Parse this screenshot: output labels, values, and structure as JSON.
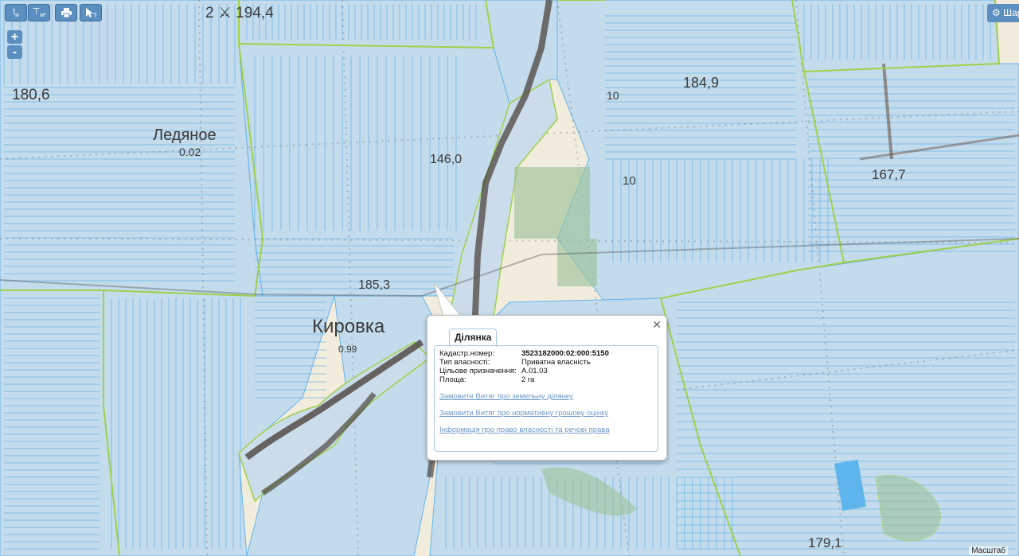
{
  "toolbar": {
    "measure_length_label": "м",
    "measure_area_label": "м²",
    "print_icon": "printer-icon",
    "identify_icon": "identify-icon"
  },
  "zoom": {
    "in_label": "+",
    "out_label": "-"
  },
  "layers_button_label": "Шар",
  "map": {
    "labels": [
      {
        "text": "2 ⚔ 194,4"
      },
      {
        "text": "180,6"
      },
      {
        "text": "Ледяное"
      },
      {
        "text": "0.02"
      },
      {
        "text": "184,9"
      },
      {
        "text": "10"
      },
      {
        "text": "146,0"
      },
      {
        "text": "167,7"
      },
      {
        "text": "10"
      },
      {
        "text": "185,3"
      },
      {
        "text": "Кировка"
      },
      {
        "text": "0.99"
      },
      {
        "text": "179,1"
      }
    ],
    "colors": {
      "parcel_fill": "#bcd8ee",
      "parcel_stroke": "#62b4ee",
      "boundary": "#9fd14a",
      "terrain": "#f2ecdc",
      "forest": "#9cc39a",
      "water": "#5db5ec"
    }
  },
  "popup": {
    "tab_label": "Ділянка",
    "close_icon": "close-icon",
    "fields": [
      {
        "key": "Кадастр.номер:",
        "value": "3523182000:02:000:5150",
        "bold": true
      },
      {
        "key": "Тип власності:",
        "value": "Приватна власність",
        "bold": false
      },
      {
        "key": "Цільове призначення:",
        "value": "A.01.03",
        "bold": false
      },
      {
        "key": "Площа:",
        "value": "2 га",
        "bold": false
      }
    ],
    "links": [
      "Замовити Витяг про земельну ділянку",
      "Замовити Витяг про нормативну грошову оцінку",
      "Інформація про право власності та речові права"
    ]
  },
  "scale_label": "Масштаб"
}
